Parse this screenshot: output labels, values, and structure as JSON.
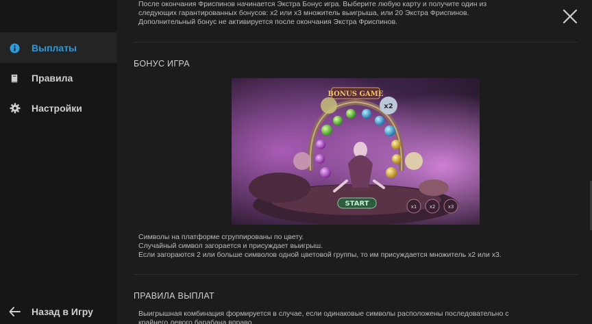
{
  "sidebar": {
    "items": [
      {
        "label": "Выплаты",
        "icon": "info-icon",
        "active": true
      },
      {
        "label": "Правила",
        "icon": "book-icon",
        "active": false
      },
      {
        "label": "Настройки",
        "icon": "gear-icon",
        "active": false
      }
    ],
    "back_label": "Назад в Игру"
  },
  "content": {
    "intro_lines": [
      "После окончания Фриспинов начинается Экстра Бонус игра. Выберите любую карту и получите один из",
      "следующих гарантированных бонусов: x2 или x3 множитель выигрыша, или 20 Экстра Фриспинов.",
      "Дополнительный бонус не активируется после окончания Экстра Фриспинов."
    ],
    "bonus_section": {
      "title": "БОНУС ИГРА",
      "image": {
        "banner": "BONUS GAME",
        "start_label": "START",
        "multiplier_badge": "x2",
        "pot_labels": [
          "x1",
          "x2",
          "x3"
        ]
      },
      "description_lines": [
        "Символы на платформе сгруппированы по цвету.",
        "Случайный символ загорается и присуждает выигрыш.",
        "Если загораются 2 или больше символов одной цветовой группы, то им присуждается множитель x2 или x3."
      ]
    },
    "payout_section": {
      "title": "ПРАВИЛА ВЫПЛАТ",
      "lines": [
        "Выигрышная комбинация формируется в случае, если одинаковые символы расположены последовательно с",
        "крайнего левого барабана вправо."
      ]
    }
  },
  "colors": {
    "accent": "#2e9ad8",
    "sidebar_bg": "#161616",
    "main_bg": "#1c1c1c"
  }
}
